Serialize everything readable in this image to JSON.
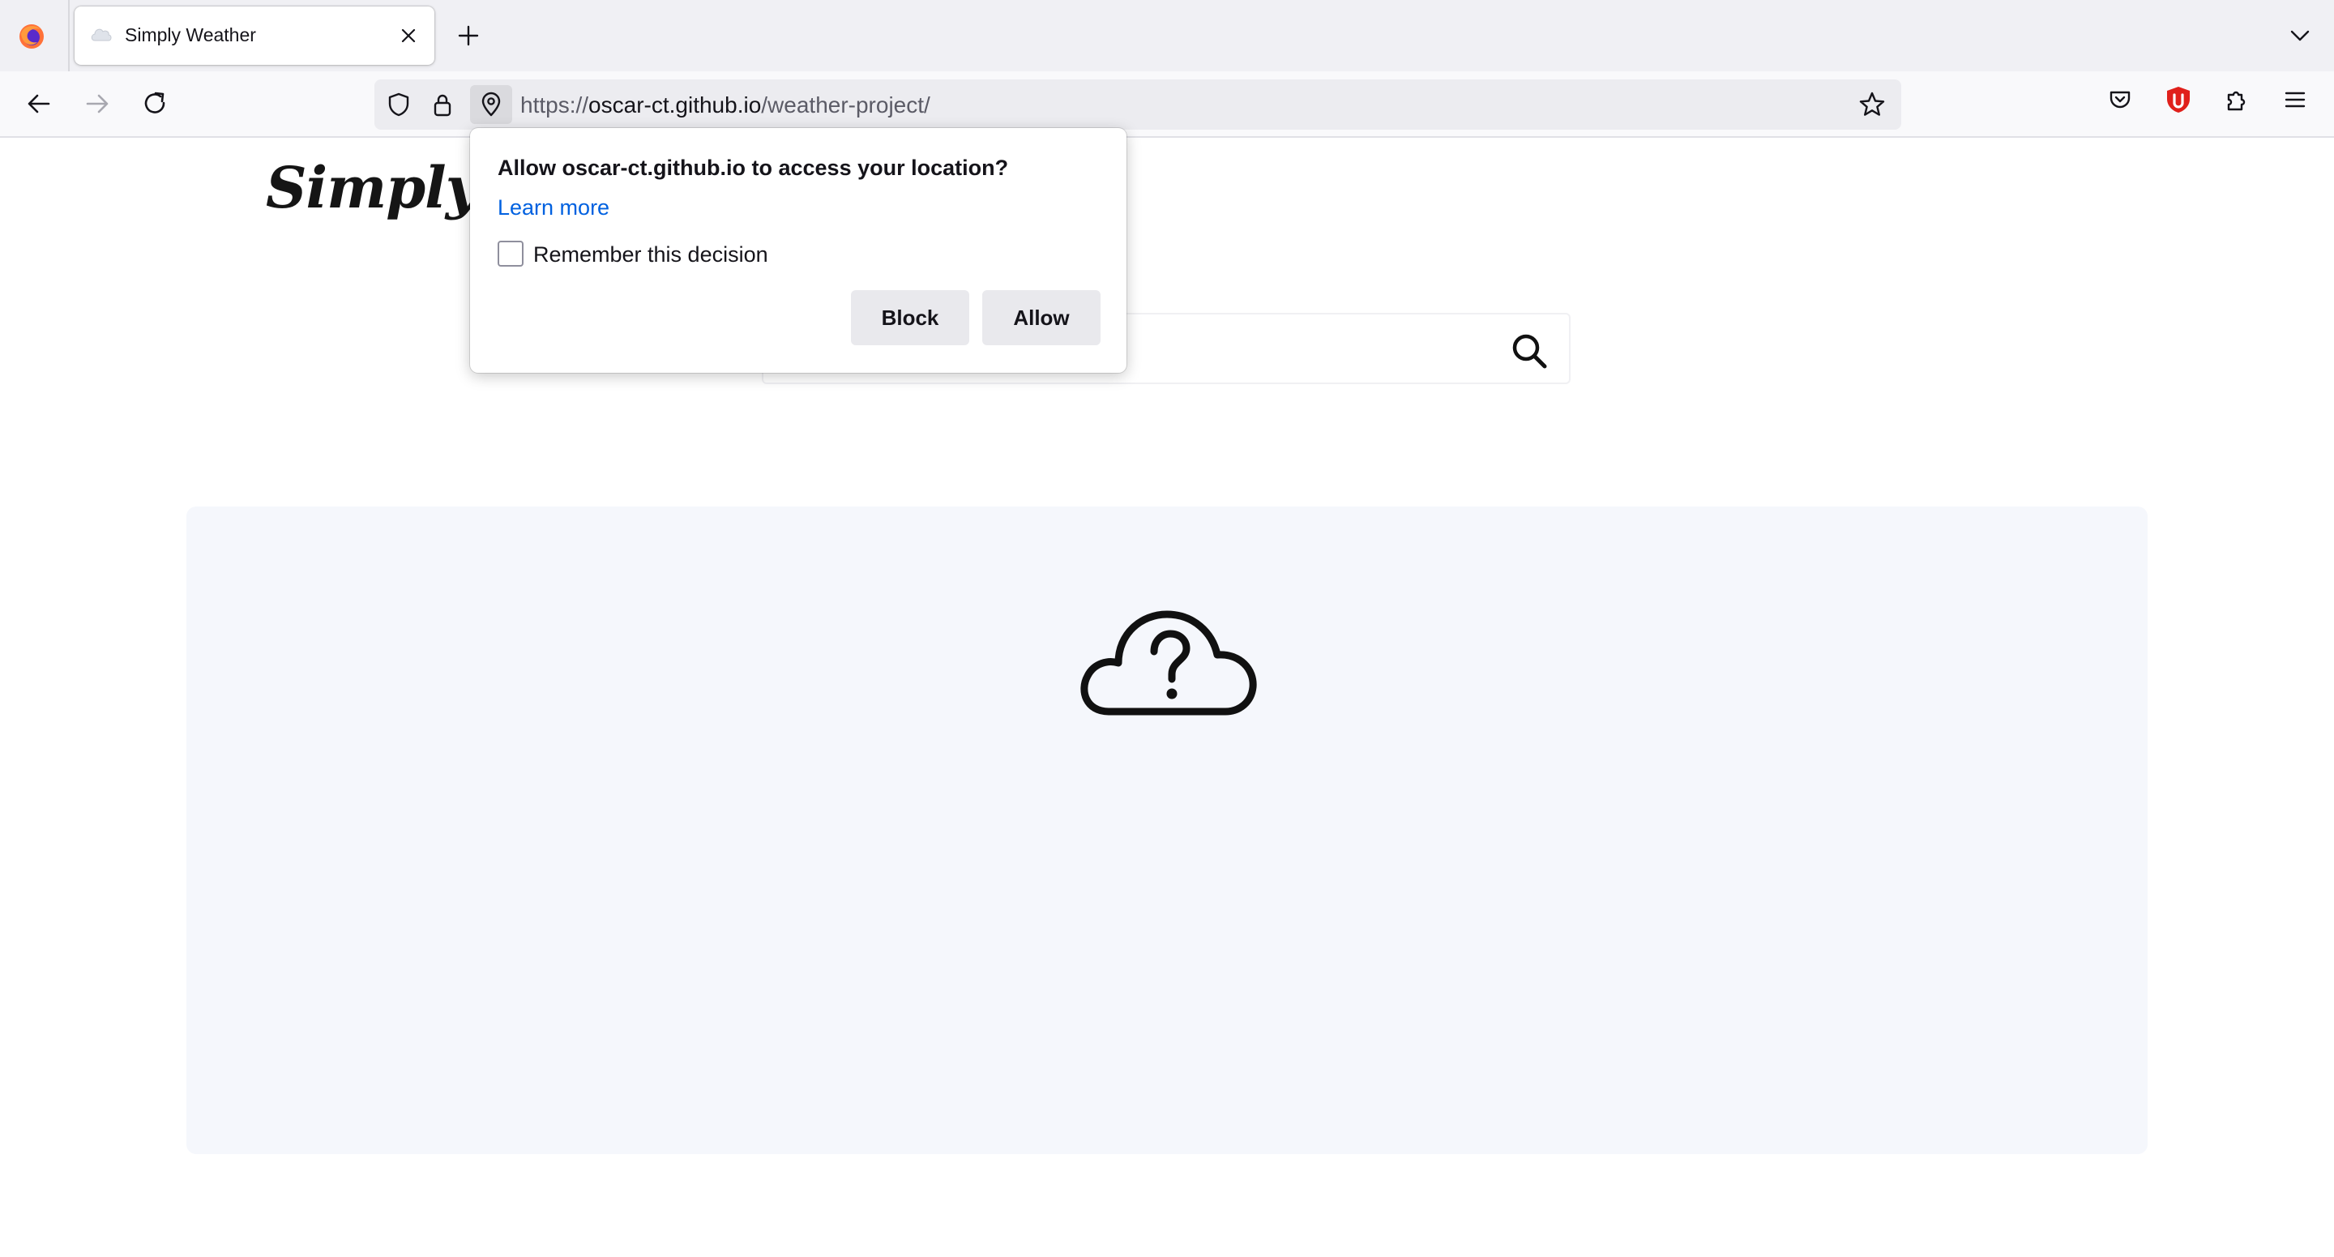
{
  "browser": {
    "tab": {
      "title": "Simply Weather",
      "favicon": "cloud-favicon"
    },
    "url": {
      "scheme": "https://",
      "host": "oscar-ct.github.io",
      "path": "/weather-project/"
    }
  },
  "page": {
    "site_title": "Simply Weather",
    "search": {
      "value": "",
      "placeholder": ""
    },
    "weather_card": {
      "icon": "cloud-question-icon"
    }
  },
  "permission_popup": {
    "message": "Allow oscar-ct.github.io to access your location?",
    "learn_more": "Learn more",
    "remember_label": "Remember this decision",
    "remember_checked": false,
    "block_label": "Block",
    "allow_label": "Allow"
  },
  "colors": {
    "chrome_bg": "#f0f0f4",
    "card_bg": "#f5f7fc",
    "link": "#0061e0",
    "extension_red": "#e0201b"
  }
}
